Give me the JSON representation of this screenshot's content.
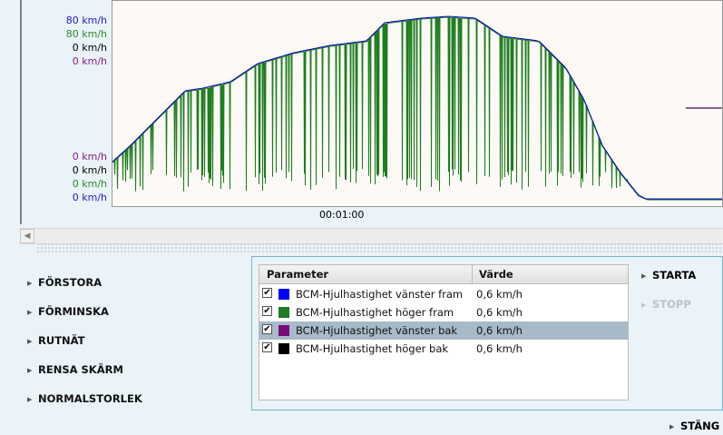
{
  "chart": {
    "top_axis_labels": [
      {
        "text": "80 km/h",
        "color": "#1a1acc"
      },
      {
        "text": "80 km/h",
        "color": "#2b8a2b"
      },
      {
        "text": "0 km/h",
        "color": "#000000"
      },
      {
        "text": "0 km/h",
        "color": "#8a1a8a"
      }
    ],
    "bottom_axis_labels": [
      {
        "text": "0 km/h",
        "color": "#8a1a8a"
      },
      {
        "text": "0 km/h",
        "color": "#000000"
      },
      {
        "text": "0 km/h",
        "color": "#2b8a2b"
      },
      {
        "text": "0 km/h",
        "color": "#1a1acc"
      }
    ],
    "time_label": "00:01:00"
  },
  "left_menu": [
    {
      "label": "FÖRSTORA"
    },
    {
      "label": "FÖRMINSKA"
    },
    {
      "label": "RUTNÄT"
    },
    {
      "label": "RENSA SKÄRM"
    },
    {
      "label": "NORMALSTORLEK"
    }
  ],
  "table": {
    "headers": {
      "parameter": "Parameter",
      "value": "Värde"
    },
    "rows": [
      {
        "name": "BCM-Hjulhastighet vänster fram",
        "value": "0,6 km/h",
        "color": "#0000ff",
        "checked": true,
        "selected": false
      },
      {
        "name": "BCM-Hjulhastighet höger fram",
        "value": "0,6 km/h",
        "color": "#1e7d1e",
        "checked": true,
        "selected": false
      },
      {
        "name": "BCM-Hjulhastighet vänster bak",
        "value": "0,6 km/h",
        "color": "#7a0a7a",
        "checked": true,
        "selected": true
      },
      {
        "name": "BCM-Hjulhastighet höger bak",
        "value": "0,6 km/h",
        "color": "#000000",
        "checked": true,
        "selected": false
      }
    ]
  },
  "buttons": {
    "start": "STARTA",
    "stop": "STOPP",
    "close": "STÄNG"
  },
  "colors": {
    "series_blue": "#0000cc",
    "series_green": "#1e7d1e",
    "series_purple": "#5a005a",
    "disabled": "#b9c3ca"
  }
}
